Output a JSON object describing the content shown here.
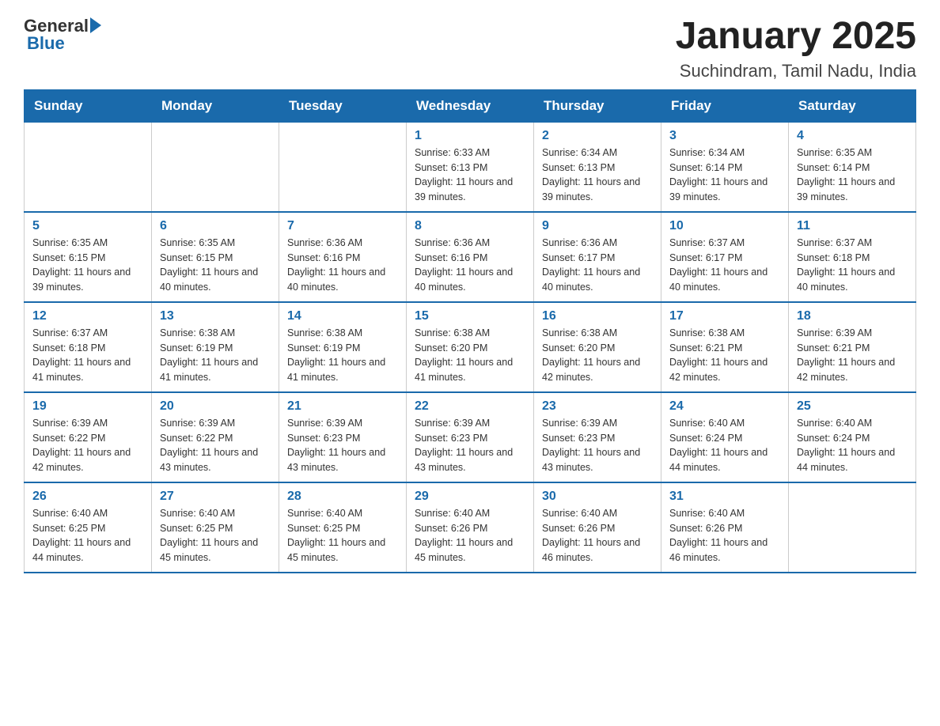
{
  "header": {
    "logo_general": "General",
    "logo_blue": "Blue",
    "title": "January 2025",
    "subtitle": "Suchindram, Tamil Nadu, India"
  },
  "days_of_week": [
    "Sunday",
    "Monday",
    "Tuesday",
    "Wednesday",
    "Thursday",
    "Friday",
    "Saturday"
  ],
  "weeks": [
    [
      {
        "day": "",
        "info": ""
      },
      {
        "day": "",
        "info": ""
      },
      {
        "day": "",
        "info": ""
      },
      {
        "day": "1",
        "info": "Sunrise: 6:33 AM\nSunset: 6:13 PM\nDaylight: 11 hours and 39 minutes."
      },
      {
        "day": "2",
        "info": "Sunrise: 6:34 AM\nSunset: 6:13 PM\nDaylight: 11 hours and 39 minutes."
      },
      {
        "day": "3",
        "info": "Sunrise: 6:34 AM\nSunset: 6:14 PM\nDaylight: 11 hours and 39 minutes."
      },
      {
        "day": "4",
        "info": "Sunrise: 6:35 AM\nSunset: 6:14 PM\nDaylight: 11 hours and 39 minutes."
      }
    ],
    [
      {
        "day": "5",
        "info": "Sunrise: 6:35 AM\nSunset: 6:15 PM\nDaylight: 11 hours and 39 minutes."
      },
      {
        "day": "6",
        "info": "Sunrise: 6:35 AM\nSunset: 6:15 PM\nDaylight: 11 hours and 40 minutes."
      },
      {
        "day": "7",
        "info": "Sunrise: 6:36 AM\nSunset: 6:16 PM\nDaylight: 11 hours and 40 minutes."
      },
      {
        "day": "8",
        "info": "Sunrise: 6:36 AM\nSunset: 6:16 PM\nDaylight: 11 hours and 40 minutes."
      },
      {
        "day": "9",
        "info": "Sunrise: 6:36 AM\nSunset: 6:17 PM\nDaylight: 11 hours and 40 minutes."
      },
      {
        "day": "10",
        "info": "Sunrise: 6:37 AM\nSunset: 6:17 PM\nDaylight: 11 hours and 40 minutes."
      },
      {
        "day": "11",
        "info": "Sunrise: 6:37 AM\nSunset: 6:18 PM\nDaylight: 11 hours and 40 minutes."
      }
    ],
    [
      {
        "day": "12",
        "info": "Sunrise: 6:37 AM\nSunset: 6:18 PM\nDaylight: 11 hours and 41 minutes."
      },
      {
        "day": "13",
        "info": "Sunrise: 6:38 AM\nSunset: 6:19 PM\nDaylight: 11 hours and 41 minutes."
      },
      {
        "day": "14",
        "info": "Sunrise: 6:38 AM\nSunset: 6:19 PM\nDaylight: 11 hours and 41 minutes."
      },
      {
        "day": "15",
        "info": "Sunrise: 6:38 AM\nSunset: 6:20 PM\nDaylight: 11 hours and 41 minutes."
      },
      {
        "day": "16",
        "info": "Sunrise: 6:38 AM\nSunset: 6:20 PM\nDaylight: 11 hours and 42 minutes."
      },
      {
        "day": "17",
        "info": "Sunrise: 6:38 AM\nSunset: 6:21 PM\nDaylight: 11 hours and 42 minutes."
      },
      {
        "day": "18",
        "info": "Sunrise: 6:39 AM\nSunset: 6:21 PM\nDaylight: 11 hours and 42 minutes."
      }
    ],
    [
      {
        "day": "19",
        "info": "Sunrise: 6:39 AM\nSunset: 6:22 PM\nDaylight: 11 hours and 42 minutes."
      },
      {
        "day": "20",
        "info": "Sunrise: 6:39 AM\nSunset: 6:22 PM\nDaylight: 11 hours and 43 minutes."
      },
      {
        "day": "21",
        "info": "Sunrise: 6:39 AM\nSunset: 6:23 PM\nDaylight: 11 hours and 43 minutes."
      },
      {
        "day": "22",
        "info": "Sunrise: 6:39 AM\nSunset: 6:23 PM\nDaylight: 11 hours and 43 minutes."
      },
      {
        "day": "23",
        "info": "Sunrise: 6:39 AM\nSunset: 6:23 PM\nDaylight: 11 hours and 43 minutes."
      },
      {
        "day": "24",
        "info": "Sunrise: 6:40 AM\nSunset: 6:24 PM\nDaylight: 11 hours and 44 minutes."
      },
      {
        "day": "25",
        "info": "Sunrise: 6:40 AM\nSunset: 6:24 PM\nDaylight: 11 hours and 44 minutes."
      }
    ],
    [
      {
        "day": "26",
        "info": "Sunrise: 6:40 AM\nSunset: 6:25 PM\nDaylight: 11 hours and 44 minutes."
      },
      {
        "day": "27",
        "info": "Sunrise: 6:40 AM\nSunset: 6:25 PM\nDaylight: 11 hours and 45 minutes."
      },
      {
        "day": "28",
        "info": "Sunrise: 6:40 AM\nSunset: 6:25 PM\nDaylight: 11 hours and 45 minutes."
      },
      {
        "day": "29",
        "info": "Sunrise: 6:40 AM\nSunset: 6:26 PM\nDaylight: 11 hours and 45 minutes."
      },
      {
        "day": "30",
        "info": "Sunrise: 6:40 AM\nSunset: 6:26 PM\nDaylight: 11 hours and 46 minutes."
      },
      {
        "day": "31",
        "info": "Sunrise: 6:40 AM\nSunset: 6:26 PM\nDaylight: 11 hours and 46 minutes."
      },
      {
        "day": "",
        "info": ""
      }
    ]
  ]
}
